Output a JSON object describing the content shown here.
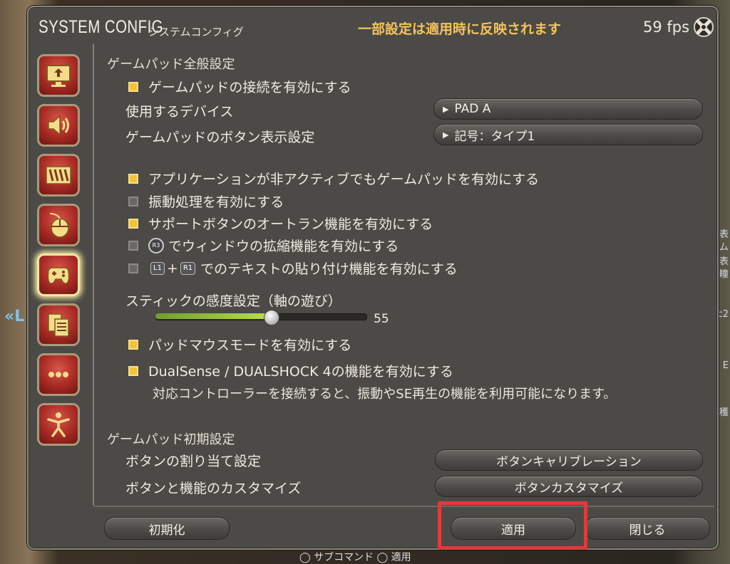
{
  "background": {
    "left_text": "«L",
    "right_fragments": [
      "表",
      "ム",
      "表",
      "ヽ",
      "瞳",
      "c2",
      "c2",
      "E",
      "穫"
    ],
    "bottom_text": "◯ サブコマンド ◯ 適用"
  },
  "window": {
    "title": "SYSTEM CONFIG",
    "subtitle": "システムコンフィグ",
    "notice": "一部設定は適用時に反映されます",
    "fps": "59 fps"
  },
  "sidebar": {
    "items": [
      {
        "name": "display",
        "icon": "monitor-icon"
      },
      {
        "name": "sound",
        "icon": "speaker-icon"
      },
      {
        "name": "ui",
        "icon": "panels-icon"
      },
      {
        "name": "mouse",
        "icon": "mouse-icon"
      },
      {
        "name": "gamepad",
        "icon": "gamepad-icon",
        "active": true
      },
      {
        "name": "other",
        "icon": "documents-icon"
      },
      {
        "name": "more",
        "icon": "dots-icon"
      },
      {
        "name": "accessibility",
        "icon": "accessibility-icon"
      }
    ]
  },
  "gamepad_general": {
    "heading": "ゲームパッド全般設定",
    "enable_connection": {
      "label": "ゲームパッドの接続を有効にする",
      "checked": true
    },
    "device": {
      "label": "使用するデバイス",
      "value": "PAD A"
    },
    "button_display": {
      "label": "ゲームパッドのボタン表示設定",
      "value": "記号：タイプ1"
    },
    "inactive_enable": {
      "label": "アプリケーションが非アクティブでもゲームパッドを有効にする",
      "checked": true
    },
    "vibration": {
      "label": "振動処理を有効にする",
      "checked": false
    },
    "support_autorun": {
      "label": "サポートボタンのオートラン機能を有効にする",
      "checked": true
    },
    "r3_window": {
      "badge": "R3",
      "label": "でウィンドウの拡縮機能を有効にする",
      "checked": false
    },
    "text_paste": {
      "badge1": "L1",
      "plus": "+",
      "badge2": "R1",
      "label": "でのテキストの貼り付け機能を有効にする",
      "checked": false
    },
    "stick_sensitivity": {
      "label": "スティックの感度設定（軸の遊び）",
      "value": "55",
      "min": 0,
      "max": 100
    },
    "pad_mouse": {
      "label": "パッドマウスモードを有効にする",
      "checked": true
    },
    "dualsense": {
      "label": "DualSense / DUALSHOCK 4の機能を有効にする",
      "checked": true,
      "note": "対応コントローラーを接続すると、振動やSE再生の機能を利用可能になります。"
    }
  },
  "gamepad_initial": {
    "heading": "ゲームパッド初期設定",
    "assign": {
      "label": "ボタンの割り当て設定",
      "button": "ボタンキャリブレーション"
    },
    "customize": {
      "label": "ボタンと機能のカスタマイズ",
      "button": "ボタンカスタマイズ"
    }
  },
  "footer": {
    "reset": "初期化",
    "apply": "適用",
    "close": "閉じる"
  },
  "colors": {
    "accent_notice": "#f4c25c",
    "checkbox_on": "#f2c23a",
    "highlight": "#e23a3a",
    "slider_fill": "#b9e04a"
  }
}
